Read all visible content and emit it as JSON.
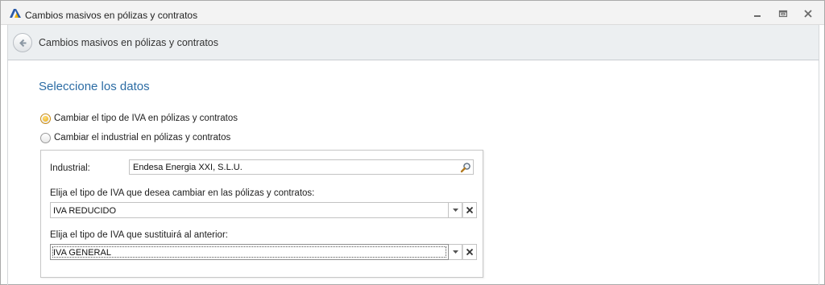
{
  "window": {
    "title": "Cambios masivos en pólizas y contratos"
  },
  "header": {
    "title": "Cambios masivos en pólizas y contratos"
  },
  "main": {
    "section_title": "Seleccione los datos",
    "options": [
      {
        "label": "Cambiar el tipo de IVA en pólizas y contratos",
        "selected": true
      },
      {
        "label": "Cambiar el industrial en pólizas y contratos",
        "selected": false
      }
    ],
    "form": {
      "industrial_label": "Industrial:",
      "industrial_value": "Endesa Energia XXI, S.L.U.",
      "current_iva_label": "Elija el tipo de IVA que desea cambiar en las pólizas y contratos:",
      "current_iva_value": "IVA REDUCIDO",
      "new_iva_label": "Elija el tipo de IVA que sustituirá al anterior:",
      "new_iva_value": "IVA GENERAL"
    }
  },
  "icons": {
    "app": "app-logo-icon",
    "minimize": "minimize-icon",
    "restore": "restore-icon",
    "close": "close-icon",
    "back": "back-arrow-icon",
    "lookup": "magnifier-icon",
    "dropdown": "chevron-down-icon",
    "clear": "clear-x-icon"
  },
  "colors": {
    "accent_title": "#2c6ca4",
    "radio_selected": "#e9a716",
    "header_bg": "#eceff1"
  }
}
